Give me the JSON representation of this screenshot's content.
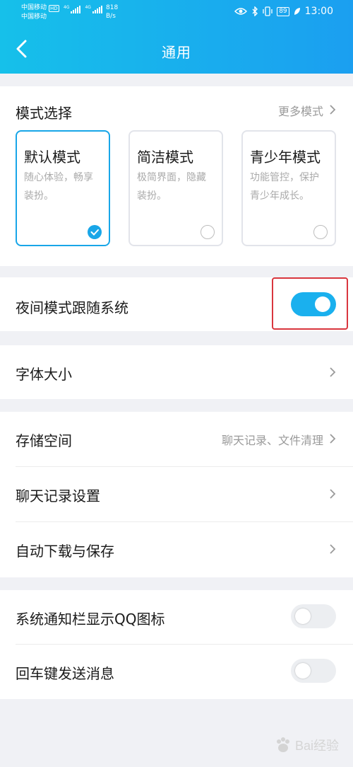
{
  "status_bar": {
    "carrier_1": "中国移动",
    "carrier_hd": "HD",
    "carrier_2": "中国移动",
    "signal_label_1": "4G",
    "signal_label_2": "4G",
    "net_speed_value": "818",
    "net_speed_unit": "B/s",
    "battery": "89",
    "time": "13:00"
  },
  "header": {
    "title": "通用"
  },
  "mode_section": {
    "title": "模式选择",
    "more_link": "更多模式",
    "modes": [
      {
        "title": "默认模式",
        "desc": "随心体验，畅享装扮。",
        "selected": true
      },
      {
        "title": "简洁模式",
        "desc": "极简界面，隐藏装扮。",
        "selected": false
      },
      {
        "title": "青少年模式",
        "desc": "功能管控，保护青少年成长。",
        "selected": false
      }
    ]
  },
  "night_mode": {
    "label": "夜间模式跟随系统",
    "enabled": true
  },
  "font_size": {
    "label": "字体大小"
  },
  "storage": {
    "label": "存储空间",
    "hint": "聊天记录、文件清理"
  },
  "chat_history": {
    "label": "聊天记录设置"
  },
  "auto_download": {
    "label": "自动下载与保存"
  },
  "notify_qq_icon": {
    "label": "系统通知栏显示QQ图标",
    "enabled": false
  },
  "enter_send": {
    "label": "回车键发送消息",
    "enabled": false
  },
  "watermark": {
    "text": "Bai经验"
  },
  "colors": {
    "accent": "#18a6e8",
    "header_start": "#16c0ea",
    "header_end": "#1b9ff0",
    "highlight_border": "#d9363e"
  }
}
